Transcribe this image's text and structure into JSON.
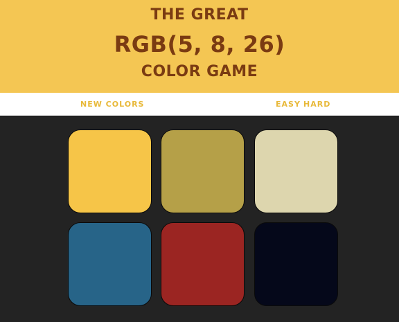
{
  "header": {
    "title_top": "THE GREAT",
    "target_color": "RGB(5, 8, 26)",
    "title_bottom": "COLOR GAME"
  },
  "nav": {
    "new_colors_label": "NEW COLORS",
    "easy_label": "EASY",
    "hard_label": "HARD"
  },
  "theme": {
    "header_bg": "#f4c653",
    "title_color": "#7a3b12",
    "button_color": "#e8b93a",
    "board_bg": "#232323"
  },
  "squares": [
    {
      "color": "#f6c548"
    },
    {
      "color": "#b5a048"
    },
    {
      "color": "#ddd6ae"
    },
    {
      "color": "#276488"
    },
    {
      "color": "#9b2522"
    },
    {
      "color": "#05081a"
    }
  ]
}
